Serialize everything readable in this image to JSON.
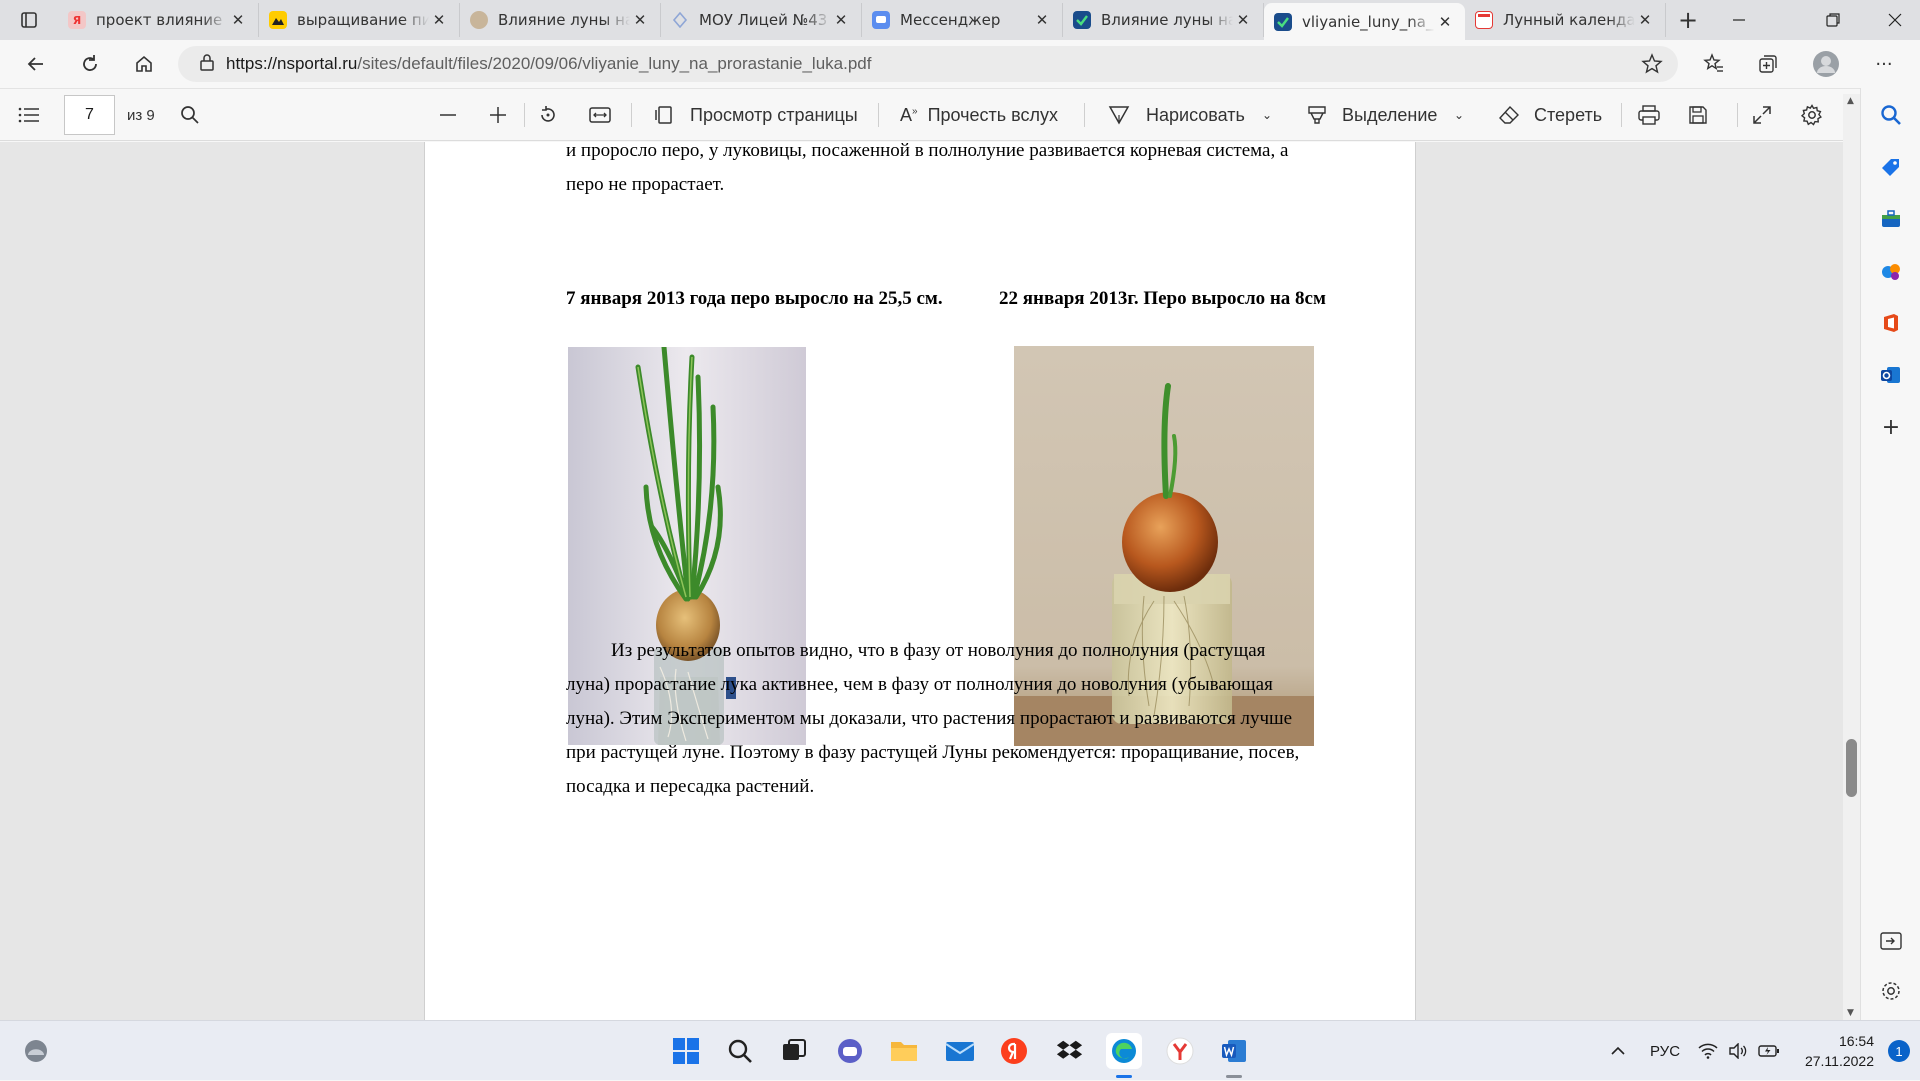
{
  "browser": {
    "tabs": [
      {
        "title": "проект влияние",
        "favicon": "yandex-icon",
        "color": "#f2f2f2"
      },
      {
        "title": "выращивание пи",
        "favicon": "yandex-zen-icon",
        "color": "#ffcc00"
      },
      {
        "title": "Влияние луны на",
        "favicon": "moon-icon",
        "color": "#c8b59a"
      },
      {
        "title": "МОУ Лицей №43",
        "favicon": "site-icon",
        "color": "#8fa6d6"
      },
      {
        "title": "Мессенджер",
        "favicon": "messenger-icon",
        "color": "#5b8def"
      },
      {
        "title": "Влияние луны на",
        "favicon": "check-icon",
        "color": "#1a4c8b"
      },
      {
        "title": "vliyanie_luny_na_",
        "favicon": "check-icon",
        "color": "#1a4c8b",
        "active": true
      },
      {
        "title": "Лунный календа",
        "favicon": "calendar-icon",
        "color": "#e53935"
      }
    ],
    "url_host": "https://nsportal.ru",
    "url_path": "/sites/default/files/2020/09/06/vliyanie_luny_na_prorastanie_luka.pdf"
  },
  "pdf_toolbar": {
    "page_current": "7",
    "page_total": "из 9",
    "page_view": "Просмотр страницы",
    "read_aloud": "Прочесть вслух",
    "draw": "Нарисовать",
    "highlight": "Выделение",
    "erase": "Стереть"
  },
  "document": {
    "top_line1": "и проросло перо, у луковицы, посаженной в полнолуние развивается корневая система, а",
    "top_line2": "перо не прорастает.",
    "caption_left": "7 января 2013 года  перо выросло на 25,5 см.",
    "caption_right": "22 января 2013г. Перо выросло на 8см",
    "para_lines": [
      "Из результатов опытов видно, что в фазу от новолуния до полнолуния (растущая",
      "луна) прорастание лука  активнее, чем в фазу от полнолуния до новолуния (убывающая",
      "луна).  Этим Экспериментом мы доказали, что растения прорастают и развиваются лучше",
      "при растущей луне. Поэтому в фазу растущей Луны рекомендуется: проращивание, посев,",
      "посадка и пересадка растений."
    ]
  },
  "taskbar": {
    "lang": "РУС",
    "time": "16:54",
    "date": "27.11.2022",
    "notifications": "1"
  }
}
